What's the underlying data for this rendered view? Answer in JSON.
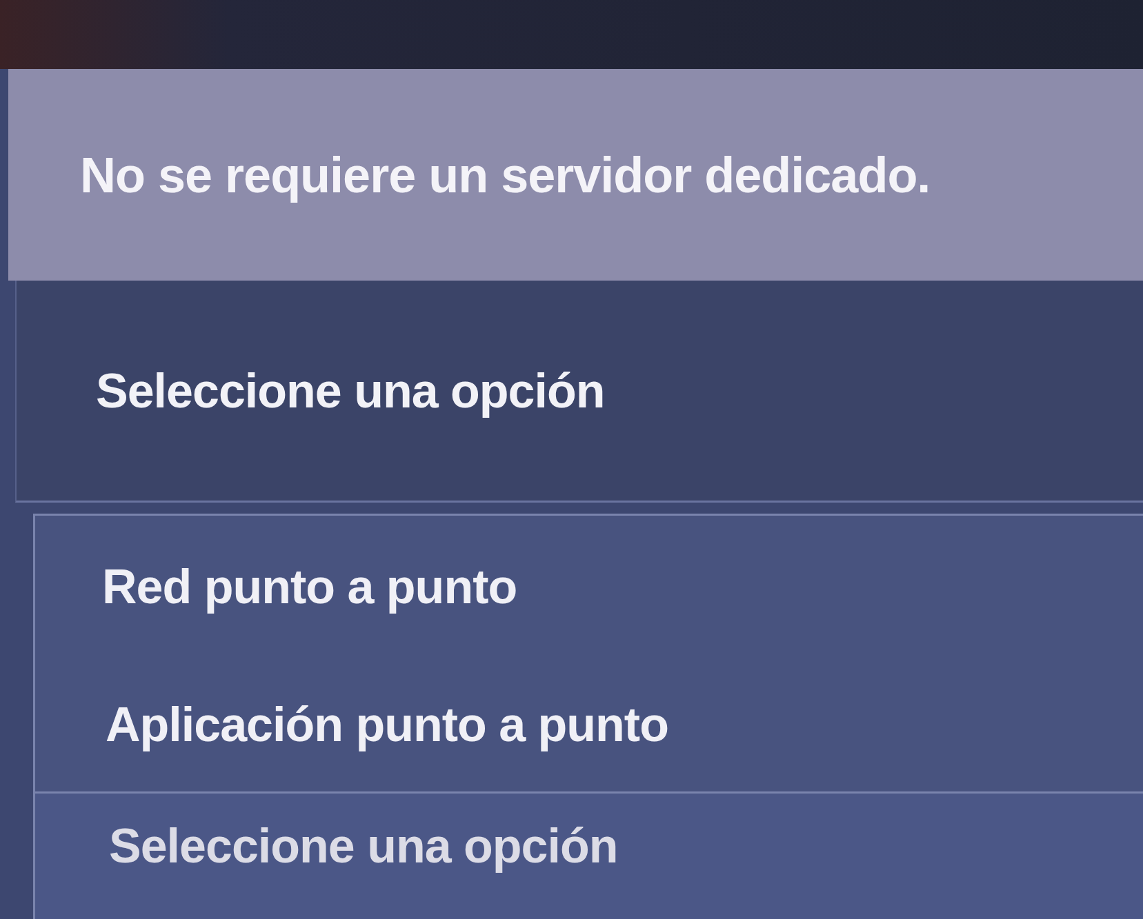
{
  "options_list": [
    {
      "label": "No se requiere un servidor dedicado.",
      "selected": true
    }
  ],
  "select": {
    "placeholder": "Seleccione una opción"
  },
  "dropdown_menu": {
    "options": [
      {
        "label": "Red punto a punto",
        "selected": false
      },
      {
        "label": "Aplicación punto a punto",
        "selected": false
      }
    ]
  },
  "select_2": {
    "placeholder": "Seleccione una opción"
  }
}
